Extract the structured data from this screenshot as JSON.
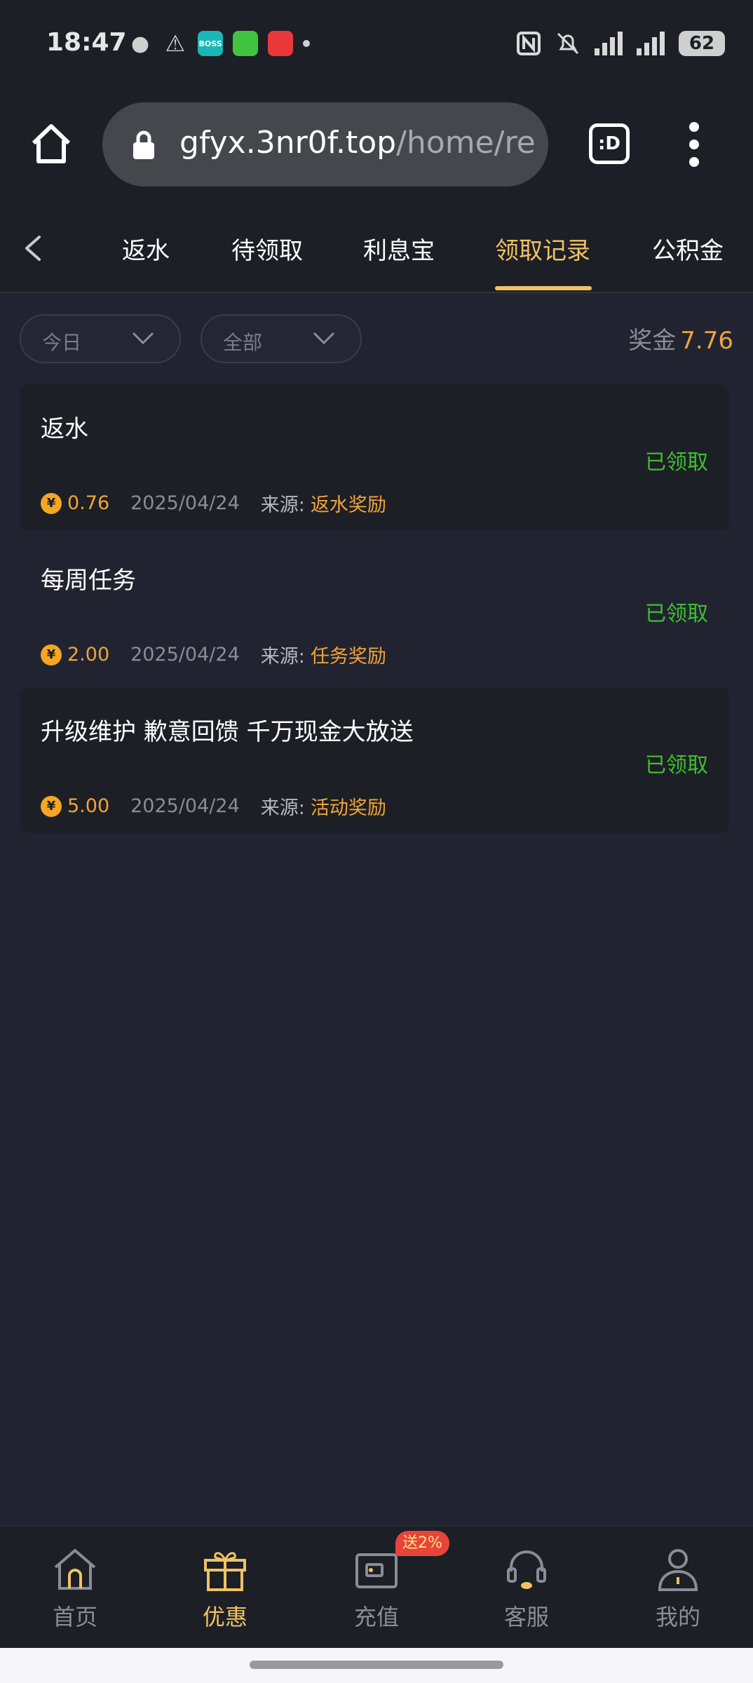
{
  "status_bar": {
    "time": "18:47",
    "left_icons": [
      "wechat-icon",
      "warning-icon",
      "boss-app-icon",
      "messages-app-icon",
      "red-app-icon",
      "notification-dot"
    ],
    "right_icons": [
      "nfc-icon",
      "mute-icon",
      "signal-5g-1",
      "signal-5g-2"
    ],
    "boss_label": "BOSS",
    "battery_level": "62"
  },
  "browser": {
    "url_host": "gfyx.3nr0f.top",
    "url_path": "/home/re",
    "tab_switch_label": ":D"
  },
  "tabs": {
    "items": [
      {
        "label": "返水",
        "active": false
      },
      {
        "label": "待领取",
        "active": false
      },
      {
        "label": "利息宝",
        "active": false
      },
      {
        "label": "领取记录",
        "active": true
      },
      {
        "label": "公积金",
        "active": false
      }
    ]
  },
  "filters": {
    "date_filter": "今日",
    "type_filter": "全部",
    "bonus_label": "奖金",
    "bonus_value": "7.76"
  },
  "records": [
    {
      "title": "返水",
      "status": "已领取",
      "amount": "0.76",
      "date": "2025/04/24",
      "source_label": "来源:",
      "source_value": "返水奖励"
    },
    {
      "title": "每周任务",
      "status": "已领取",
      "amount": "2.00",
      "date": "2025/04/24",
      "source_label": "来源:",
      "source_value": "任务奖励"
    },
    {
      "title": "升级维护 歉意回馈 千万现金大放送",
      "status": "已领取",
      "amount": "5.00",
      "date": "2025/04/24",
      "source_label": "来源:",
      "source_value": "活动奖励"
    }
  ],
  "coin_symbol": "¥",
  "bottom_nav": {
    "items": [
      {
        "label": "首页",
        "icon": "home-icon",
        "active": false
      },
      {
        "label": "优惠",
        "icon": "gift-icon",
        "active": true
      },
      {
        "label": "充值",
        "icon": "wallet-icon",
        "active": false,
        "badge": "送2%"
      },
      {
        "label": "客服",
        "icon": "headset-icon",
        "active": false
      },
      {
        "label": "我的",
        "icon": "user-icon",
        "active": false
      }
    ]
  },
  "colors": {
    "background": "#212430",
    "card": "#1d1f26",
    "accent": "#f0c263",
    "amount": "#f0a43a",
    "success": "#3fbf2f",
    "badge": "#e8443a"
  }
}
